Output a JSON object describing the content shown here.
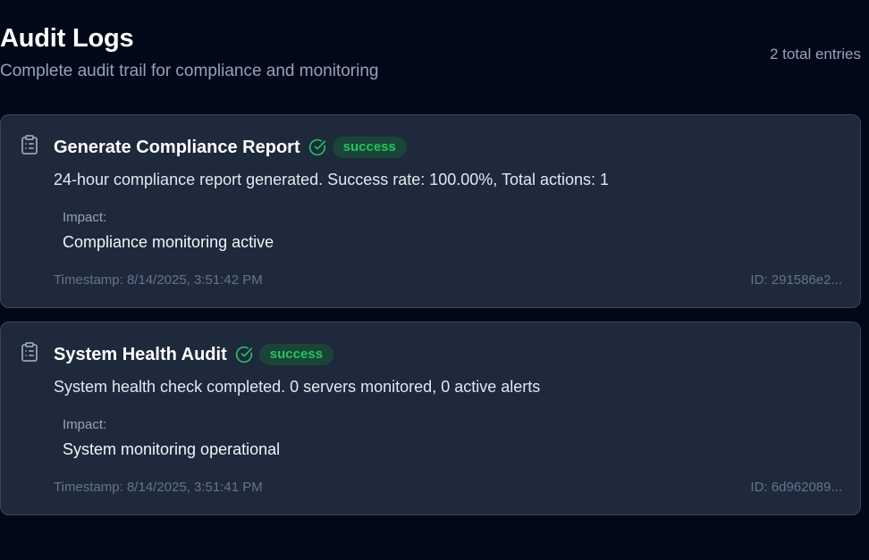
{
  "header": {
    "title": "Audit Logs",
    "subtitle": "Complete audit trail for compliance and monitoring",
    "entry_count": "2 total entries"
  },
  "logs": [
    {
      "icon": "clipboard-icon",
      "title": "Generate Compliance Report",
      "status": "success",
      "status_icon": "check-circle-icon",
      "description": "24-hour compliance report generated. Success rate: 100.00%, Total actions: 1",
      "impact_label": "Impact:",
      "impact": "Compliance monitoring active",
      "timestamp": "Timestamp: 8/14/2025, 3:51:42 PM",
      "id": "ID: 291586e2..."
    },
    {
      "icon": "clipboard-icon",
      "title": "System Health Audit",
      "status": "success",
      "status_icon": "check-circle-icon",
      "description": "System health check completed. 0 servers monitored, 0 active alerts",
      "impact_label": "Impact:",
      "impact": "System monitoring operational",
      "timestamp": "Timestamp: 8/14/2025, 3:51:41 PM",
      "id": "ID: 6d962089..."
    }
  ],
  "colors": {
    "background": "#020817",
    "card": "#1e293b",
    "success": "#22c55e",
    "muted": "#94a3b8"
  }
}
